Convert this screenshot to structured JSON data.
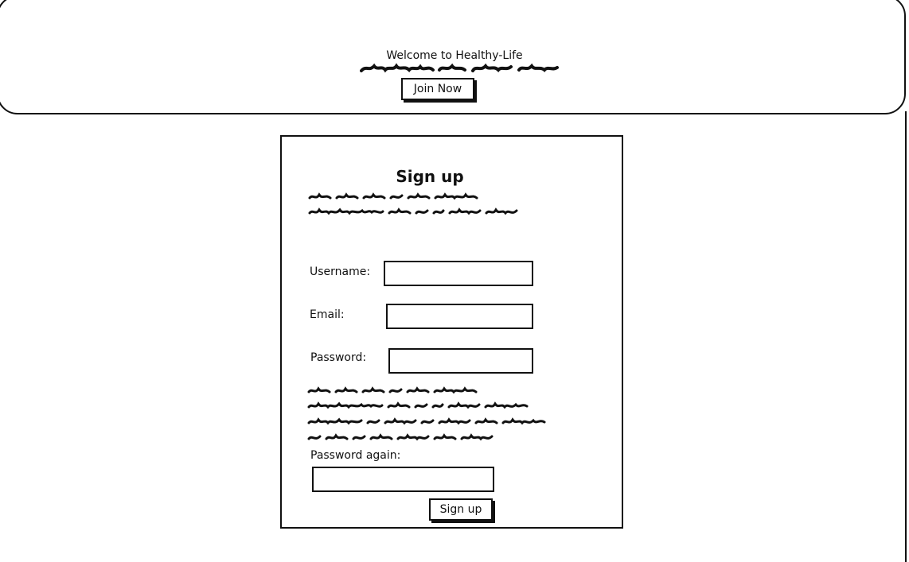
{
  "banner": {
    "welcome_text": "Welcome to Healthy-Life",
    "join_label": "Join Now"
  },
  "signup": {
    "title": "Sign up",
    "username_label": "Username:",
    "username_value": "",
    "email_label": "Email:",
    "email_value": "",
    "password_label": "Password:",
    "password_value": "",
    "password_again_label": "Password again:",
    "password_again_value": "",
    "submit_label": "Sign up"
  }
}
